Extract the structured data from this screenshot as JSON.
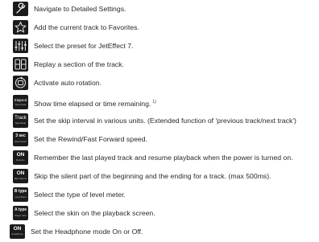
{
  "items": [
    {
      "icon": "wrench-icon",
      "text": "Navigate to Detailed Settings."
    },
    {
      "icon": "star-icon",
      "text": "Add the current track to Favorites."
    },
    {
      "icon": "equalizer-sliders-icon",
      "text": "Select the preset for JetEffect 7."
    },
    {
      "icon": "ab-repeat-icon",
      "text": "Replay a section of the track."
    },
    {
      "icon": "auto-rotation-icon",
      "text": "Activate auto rotation."
    },
    {
      "icon": "elapsed-time-icon",
      "icon_label": "Elapsed",
      "icon_sub": "Time Mode",
      "text": "Show time elapsed or time remaining.",
      "note": "1)"
    },
    {
      "icon": "track-skip-icon",
      "icon_label": "Track",
      "icon_sub": "Skip Mode",
      "text": "Set the skip interval in various units. (Extended function of 'previous track/next track')"
    },
    {
      "icon": "seek-speed-icon",
      "icon_label": "3 sec",
      "icon_sub": "Seek Speed",
      "text": "Set the Rewind/Fast Forward speed."
    },
    {
      "icon": "resume-on-icon",
      "icon_label": "ON",
      "icon_sub": "Resume",
      "text": "Remember the last played track and resume playback when the power is turned on."
    },
    {
      "icon": "silence-skip-on-icon",
      "icon_label": "ON",
      "icon_sub": "Skip Silence",
      "text": "Skip the silent part of the beginning and the ending for a track. (max 500ms)."
    },
    {
      "icon": "level-meter-icon",
      "icon_label": "B type",
      "icon_sub": "Level Meter",
      "text": "Select the type of level meter."
    },
    {
      "icon": "skin-icon",
      "icon_label": "A type",
      "icon_sub": "Player Skin",
      "text": "Select the skin on the playback screen."
    },
    {
      "icon": "headphone-mode-on-icon",
      "icon_label": "ON",
      "icon_sub": "Headphone",
      "text": "Set the Headphone mode On or Off."
    }
  ]
}
